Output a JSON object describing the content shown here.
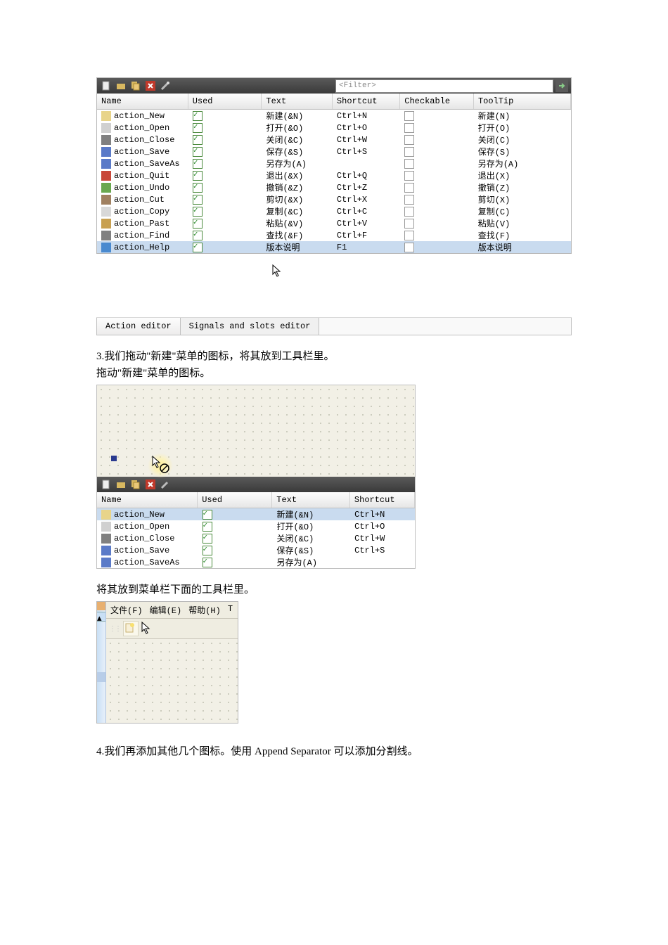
{
  "filter_placeholder": "<Filter>",
  "headers1": [
    "Name",
    "Used",
    "Text",
    "Shortcut",
    "Checkable",
    "ToolTip"
  ],
  "actions1": [
    {
      "name": "action_New",
      "text": "新建(&N)",
      "shortcut": "Ctrl+N",
      "tooltip": "新建(N)",
      "ico": "#e8d48a"
    },
    {
      "name": "action_Open",
      "text": "打开(&O)",
      "shortcut": "Ctrl+O",
      "tooltip": "打开(O)",
      "ico": "#d0d0d0"
    },
    {
      "name": "action_Close",
      "text": "关闭(&C)",
      "shortcut": "Ctrl+W",
      "tooltip": "关闭(C)",
      "ico": "#808080"
    },
    {
      "name": "action_Save",
      "text": "保存(&S)",
      "shortcut": "Ctrl+S",
      "tooltip": "保存(S)",
      "ico": "#5a7ac8"
    },
    {
      "name": "action_SaveAs",
      "text": "另存为(A)",
      "shortcut": "",
      "tooltip": "另存为(A)",
      "ico": "#5a7ac8"
    },
    {
      "name": "action_Quit",
      "text": "退出(&X)",
      "shortcut": "Ctrl+Q",
      "tooltip": "退出(X)",
      "ico": "#c8483a"
    },
    {
      "name": "action_Undo",
      "text": "撤销(&Z)",
      "shortcut": "Ctrl+Z",
      "tooltip": "撤销(Z)",
      "ico": "#6aa84f"
    },
    {
      "name": "action_Cut",
      "text": "剪切(&X)",
      "shortcut": "Ctrl+X",
      "tooltip": "剪切(X)",
      "ico": "#a08060"
    },
    {
      "name": "action_Copy",
      "text": "复制(&C)",
      "shortcut": "Ctrl+C",
      "tooltip": "复制(C)",
      "ico": "#d8d8d8"
    },
    {
      "name": "action_Past",
      "text": "粘贴(&V)",
      "shortcut": "Ctrl+V",
      "tooltip": "粘贴(V)",
      "ico": "#c8a050"
    },
    {
      "name": "action_Find",
      "text": "查找(&F)",
      "shortcut": "Ctrl+F",
      "tooltip": "查找(F)",
      "ico": "#808080"
    },
    {
      "name": "action_Help",
      "text": "版本说明",
      "shortcut": "F1",
      "tooltip": "版本说明",
      "ico": "#4a8acf",
      "sel": true
    }
  ],
  "tabs": {
    "active": "Action editor",
    "inactive": "Signals and slots editor"
  },
  "para1_line1": "3.我们拖动\"新建\"菜单的图标，将其放到工具栏里。",
  "para1_line2": "拖动\"新建\"菜单的图标。",
  "headers2": [
    "Name",
    "Used",
    "Text",
    "Shortcut"
  ],
  "actions2": [
    {
      "name": "action_New",
      "text": "新建(&N)",
      "shortcut": "Ctrl+N",
      "ico": "#e8d48a",
      "sel": true
    },
    {
      "name": "action_Open",
      "text": "打开(&O)",
      "shortcut": "Ctrl+O",
      "ico": "#d0d0d0"
    },
    {
      "name": "action_Close",
      "text": "关闭(&C)",
      "shortcut": "Ctrl+W",
      "ico": "#808080"
    },
    {
      "name": "action_Save",
      "text": "保存(&S)",
      "shortcut": "Ctrl+S",
      "ico": "#5a7ac8"
    },
    {
      "name": "action_SaveAs",
      "text": "另存为(A)",
      "shortcut": "",
      "ico": "#5a7ac8"
    }
  ],
  "para2": "将其放到菜单栏下面的工具栏里。",
  "menubar": [
    "文件(F)",
    "编辑(E)",
    "帮助(H)",
    "T"
  ],
  "para3": "4.我们再添加其他几个图标。使用 Append Separator 可以添加分割线。"
}
